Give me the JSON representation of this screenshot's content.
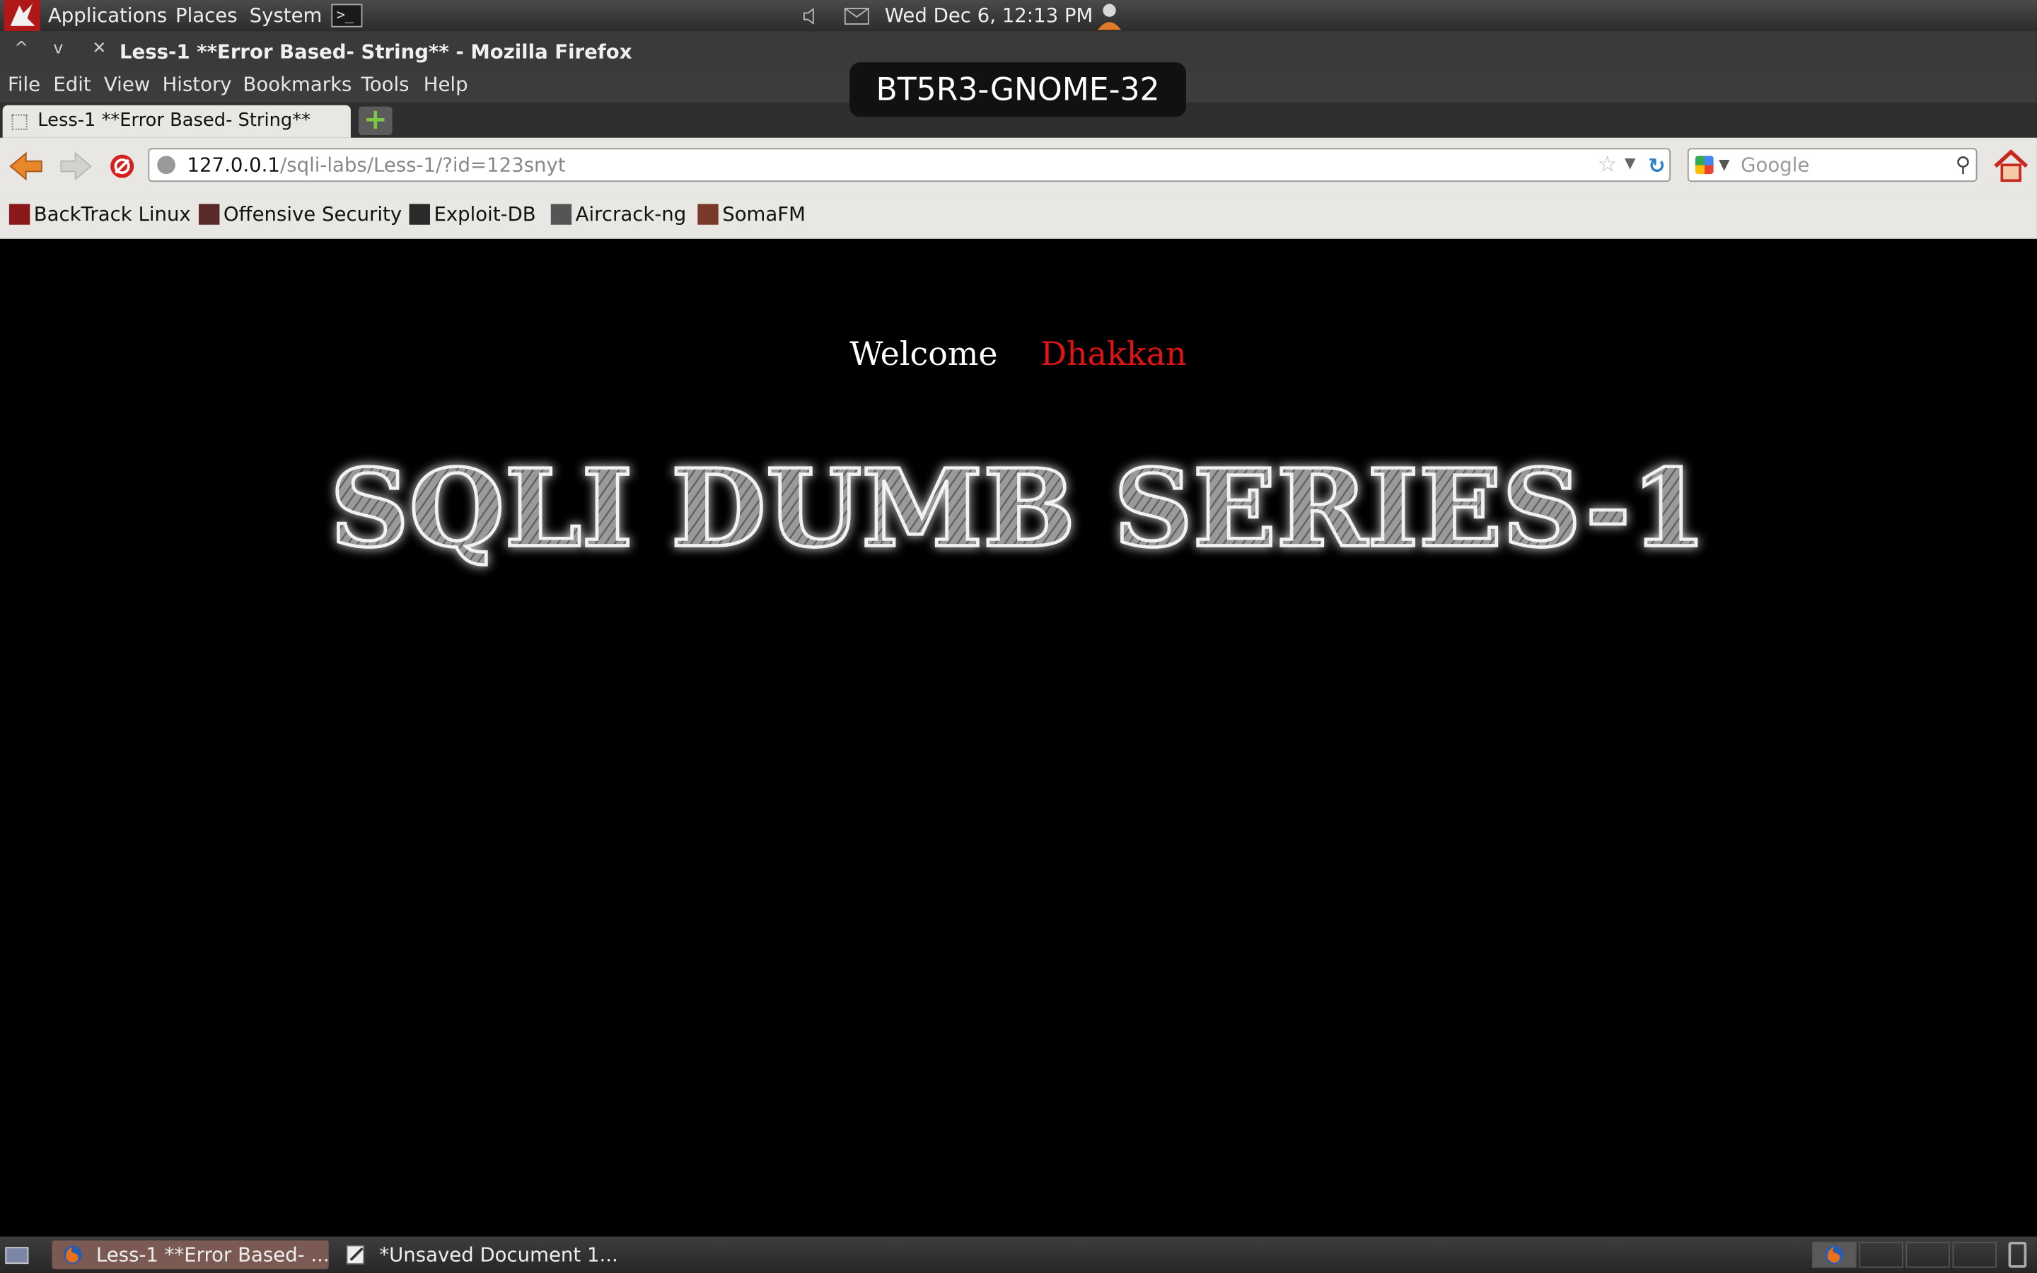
{
  "top_panel": {
    "menus": [
      "Applications",
      "Places",
      "System"
    ],
    "datetime": "Wed Dec  6, 12:13 PM"
  },
  "window": {
    "title": "Less-1 **Error Based- String** - Mozilla Firefox",
    "hostname_overlay": "BT5R3-GNOME-32"
  },
  "menubar": {
    "items": [
      {
        "label": "File"
      },
      {
        "label": "Edit"
      },
      {
        "label": "View"
      },
      {
        "label": "History"
      },
      {
        "label": "Bookmarks"
      },
      {
        "label": "Tools"
      },
      {
        "label": "Help"
      }
    ]
  },
  "tabs": [
    {
      "label": "Less-1 **Error Based- String**",
      "active": true
    }
  ],
  "navbar": {
    "url_host": "127.0.0.1",
    "url_path": "/sqli-labs/Less-1/?id=123snyt",
    "search_placeholder": "Google"
  },
  "bookmarks": [
    {
      "label": "BackTrack Linux"
    },
    {
      "label": "Offensive Security"
    },
    {
      "label": "Exploit-DB"
    },
    {
      "label": "Aircrack-ng"
    },
    {
      "label": "SomaFM"
    }
  ],
  "page": {
    "welcome": "Welcome",
    "name": "Dhakkan",
    "banner_text": "SQLI DUMB SERIES-1"
  },
  "taskbar": {
    "tasks": [
      {
        "label": "Less-1 **Error Based- ..."
      },
      {
        "label": "*Unsaved Document 1..."
      }
    ]
  },
  "colors": {
    "page_background": "#000000",
    "welcome_text": "#ffffff",
    "name_text": "#e31313"
  }
}
